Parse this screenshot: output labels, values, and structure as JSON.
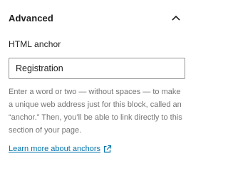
{
  "panel": {
    "title": "Advanced",
    "expanded": true,
    "toggle_icon": "chevron-up-icon"
  },
  "anchor_field": {
    "label": "HTML anchor",
    "value": "Registration",
    "help_text": "Enter a word or two — without spaces — to make a unique web address just for this block, called an “anchor.” Then, you’ll be able to link directly to this section of your page.",
    "link_label": "Learn more about anchors",
    "link_icon": "external-link-icon"
  },
  "colors": {
    "text": "#1e1e1e",
    "muted": "#757575",
    "link": "#0073aa",
    "border": "#949494"
  }
}
